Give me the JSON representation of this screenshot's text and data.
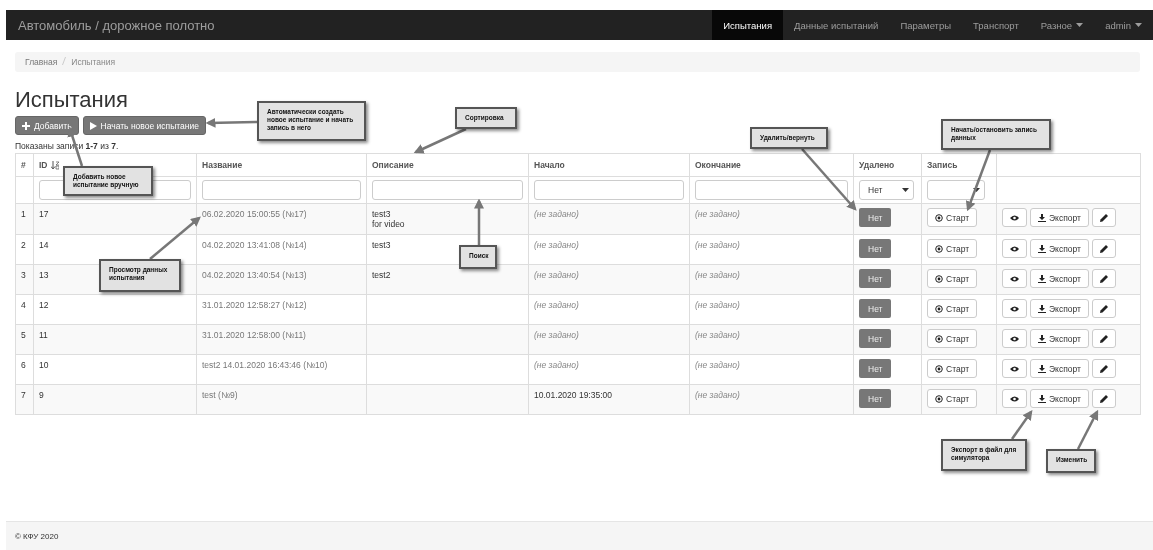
{
  "navbar": {
    "brand": "Автомобиль / дорожное полотно",
    "items": [
      {
        "label": "Испытания",
        "selected": true,
        "dropdown": false
      },
      {
        "label": "Данные испытаний",
        "selected": false,
        "dropdown": false
      },
      {
        "label": "Параметры",
        "selected": false,
        "dropdown": false
      },
      {
        "label": "Транспорт",
        "selected": false,
        "dropdown": false
      },
      {
        "label": "Разное",
        "selected": false,
        "dropdown": true
      },
      {
        "label": "admin",
        "selected": false,
        "dropdown": true
      }
    ]
  },
  "breadcrumb": [
    {
      "label": "Главная",
      "current": false
    },
    {
      "label": "Испытания",
      "current": true
    }
  ],
  "title": "Испытания",
  "toolbar": [
    {
      "label": "Добавить",
      "kind": "add"
    },
    {
      "label": "Начать новое испытание",
      "kind": "start"
    }
  ],
  "summary": "Показаны записи **1-7** из **7**.",
  "table": {
    "columns": [
      {
        "label": "#",
        "sorted": false
      },
      {
        "label": "ID",
        "sorted": true
      },
      {
        "label": "Название",
        "sorted": false
      },
      {
        "label": "Описание",
        "sorted": false
      },
      {
        "label": "Начало",
        "sorted": false
      },
      {
        "label": "Окончание",
        "sorted": false
      },
      {
        "label": "Удалено",
        "sorted": false
      },
      {
        "label": "Запись",
        "sorted": false
      }
    ],
    "filters": [
      {
        "kind": "input"
      },
      {
        "kind": "input"
      },
      {
        "kind": "input"
      },
      {
        "kind": "input"
      },
      {
        "kind": "input"
      },
      {
        "kind": "select",
        "value": "Нет"
      },
      {
        "kind": "select"
      }
    ],
    "rows": [
      {
        "num": "1",
        "id": "17",
        "name": "06.02.2020 15:00:55 (№17)",
        "description": "test3\nfor video",
        "start": {
          "text": "(не задано)",
          "empty": true
        },
        "end": {
          "text": "(не задано)",
          "empty": true
        },
        "deleted": "Нет",
        "record": "Старт",
        "export": "Экспорт"
      },
      {
        "num": "2",
        "id": "14",
        "name": "04.02.2020 13:41:08 (№14)",
        "description": "test3",
        "start": {
          "text": "(не задано)",
          "empty": true
        },
        "end": {
          "text": "(не задано)",
          "empty": true
        },
        "deleted": "Нет",
        "record": "Старт",
        "export": "Экспорт"
      },
      {
        "num": "3",
        "id": "13",
        "name": "04.02.2020 13:40:54 (№13)",
        "description": "test2",
        "start": {
          "text": "(не задано)",
          "empty": true
        },
        "end": {
          "text": "(не задано)",
          "empty": true
        },
        "deleted": "Нет",
        "record": "Старт",
        "export": "Экспорт"
      },
      {
        "num": "4",
        "id": "12",
        "name": "31.01.2020 12:58:27 (№12)",
        "start": {
          "text": "(не задано)",
          "empty": true
        },
        "end": {
          "text": "(не задано)",
          "empty": true
        },
        "deleted": "Нет",
        "record": "Старт",
        "export": "Экспорт"
      },
      {
        "num": "5",
        "id": "11",
        "name": "31.01.2020 12:58:00 (№11)",
        "start": {
          "text": "(не задано)",
          "empty": true
        },
        "end": {
          "text": "(не задано)",
          "empty": true
        },
        "deleted": "Нет",
        "record": "Старт",
        "export": "Экспорт"
      },
      {
        "num": "6",
        "id": "10",
        "name": "test2 14.01.2020 16:43:46 (№10)",
        "start": {
          "text": "(не задано)",
          "empty": true
        },
        "end": {
          "text": "(не задано)",
          "empty": true
        },
        "deleted": "Нет",
        "record": "Старт",
        "export": "Экспорт"
      },
      {
        "num": "7",
        "id": "9",
        "name": "test (№9)",
        "start": {
          "text": "10.01.2020 19:35:00",
          "empty": false
        },
        "end": {
          "text": "(не задано)",
          "empty": true
        },
        "deleted": "Нет",
        "record": "Старт",
        "export": "Экспорт"
      }
    ]
  },
  "callouts": [
    {
      "text": "Автоматически создать новое испытание и начать запись в него"
    },
    {
      "text": "Сортировка"
    },
    {
      "text": "Добавить новое испытание вручную"
    },
    {
      "text": "Удалить/вернуть"
    },
    {
      "text": "Начать/остановить запись данных"
    },
    {
      "text": "Поиск"
    },
    {
      "text": "Просмотр данных испытания"
    },
    {
      "text": "Экспорт в файл для симулятора"
    },
    {
      "text": "Изменить"
    }
  ],
  "footer": "© КФУ 2020"
}
